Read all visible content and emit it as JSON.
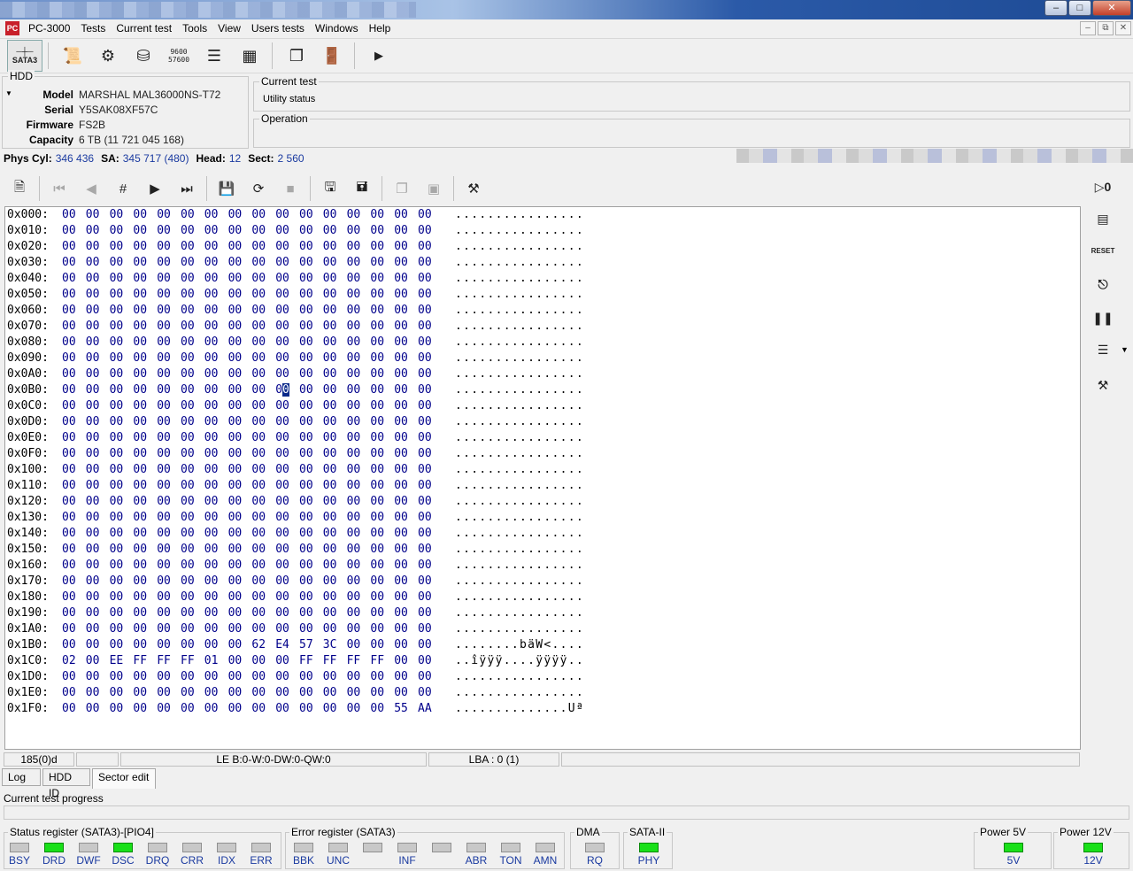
{
  "window": {
    "min": "–",
    "max": "□",
    "close": "✕"
  },
  "menu": {
    "app_icon_text": "PC",
    "items": [
      "PC-3000",
      "Tests",
      "Current test",
      "Tools",
      "View",
      "Users tests",
      "Windows",
      "Help"
    ],
    "mdi": [
      "–",
      "⧉",
      "✕"
    ]
  },
  "toolbar": {
    "sata_label": "SATA3",
    "baud_top": "9600",
    "baud_bottom": "57600"
  },
  "hdd": {
    "legend": "HDD",
    "fields": [
      {
        "label": "Model",
        "value": "MARSHAL MAL36000NS-T72"
      },
      {
        "label": "Serial",
        "value": "Y5SAK08XF57C"
      },
      {
        "label": "Firmware",
        "value": "FS2B"
      },
      {
        "label": "Capacity",
        "value": "6 TB (11 721 045 168)"
      }
    ]
  },
  "current_test": {
    "legend": "Current test",
    "status": "Utility status"
  },
  "operation": {
    "legend": "Operation"
  },
  "position": {
    "phys_cyl_label": "Phys Cyl:",
    "phys_cyl": "346 436",
    "sa_label": "SA:",
    "sa": "345 717 (480)",
    "head_label": "Head:",
    "head": "12",
    "sect_label": "Sect:",
    "sect": "2 560"
  },
  "hex": {
    "cursor": {
      "row": 11,
      "col": 9
    },
    "rows": [
      {
        "addr": "0x000:",
        "bytes": [
          "00",
          "00",
          "00",
          "00",
          "00",
          "00",
          "00",
          "00",
          "00",
          "00",
          "00",
          "00",
          "00",
          "00",
          "00",
          "00"
        ],
        "ascii": "................"
      },
      {
        "addr": "0x010:",
        "bytes": [
          "00",
          "00",
          "00",
          "00",
          "00",
          "00",
          "00",
          "00",
          "00",
          "00",
          "00",
          "00",
          "00",
          "00",
          "00",
          "00"
        ],
        "ascii": "................"
      },
      {
        "addr": "0x020:",
        "bytes": [
          "00",
          "00",
          "00",
          "00",
          "00",
          "00",
          "00",
          "00",
          "00",
          "00",
          "00",
          "00",
          "00",
          "00",
          "00",
          "00"
        ],
        "ascii": "................"
      },
      {
        "addr": "0x030:",
        "bytes": [
          "00",
          "00",
          "00",
          "00",
          "00",
          "00",
          "00",
          "00",
          "00",
          "00",
          "00",
          "00",
          "00",
          "00",
          "00",
          "00"
        ],
        "ascii": "................"
      },
      {
        "addr": "0x040:",
        "bytes": [
          "00",
          "00",
          "00",
          "00",
          "00",
          "00",
          "00",
          "00",
          "00",
          "00",
          "00",
          "00",
          "00",
          "00",
          "00",
          "00"
        ],
        "ascii": "................"
      },
      {
        "addr": "0x050:",
        "bytes": [
          "00",
          "00",
          "00",
          "00",
          "00",
          "00",
          "00",
          "00",
          "00",
          "00",
          "00",
          "00",
          "00",
          "00",
          "00",
          "00"
        ],
        "ascii": "................"
      },
      {
        "addr": "0x060:",
        "bytes": [
          "00",
          "00",
          "00",
          "00",
          "00",
          "00",
          "00",
          "00",
          "00",
          "00",
          "00",
          "00",
          "00",
          "00",
          "00",
          "00"
        ],
        "ascii": "................"
      },
      {
        "addr": "0x070:",
        "bytes": [
          "00",
          "00",
          "00",
          "00",
          "00",
          "00",
          "00",
          "00",
          "00",
          "00",
          "00",
          "00",
          "00",
          "00",
          "00",
          "00"
        ],
        "ascii": "................"
      },
      {
        "addr": "0x080:",
        "bytes": [
          "00",
          "00",
          "00",
          "00",
          "00",
          "00",
          "00",
          "00",
          "00",
          "00",
          "00",
          "00",
          "00",
          "00",
          "00",
          "00"
        ],
        "ascii": "................"
      },
      {
        "addr": "0x090:",
        "bytes": [
          "00",
          "00",
          "00",
          "00",
          "00",
          "00",
          "00",
          "00",
          "00",
          "00",
          "00",
          "00",
          "00",
          "00",
          "00",
          "00"
        ],
        "ascii": "................"
      },
      {
        "addr": "0x0A0:",
        "bytes": [
          "00",
          "00",
          "00",
          "00",
          "00",
          "00",
          "00",
          "00",
          "00",
          "00",
          "00",
          "00",
          "00",
          "00",
          "00",
          "00"
        ],
        "ascii": "................"
      },
      {
        "addr": "0x0B0:",
        "bytes": [
          "00",
          "00",
          "00",
          "00",
          "00",
          "00",
          "00",
          "00",
          "00",
          "00",
          "00",
          "00",
          "00",
          "00",
          "00",
          "00"
        ],
        "ascii": "................"
      },
      {
        "addr": "0x0C0:",
        "bytes": [
          "00",
          "00",
          "00",
          "00",
          "00",
          "00",
          "00",
          "00",
          "00",
          "00",
          "00",
          "00",
          "00",
          "00",
          "00",
          "00"
        ],
        "ascii": "................"
      },
      {
        "addr": "0x0D0:",
        "bytes": [
          "00",
          "00",
          "00",
          "00",
          "00",
          "00",
          "00",
          "00",
          "00",
          "00",
          "00",
          "00",
          "00",
          "00",
          "00",
          "00"
        ],
        "ascii": "................"
      },
      {
        "addr": "0x0E0:",
        "bytes": [
          "00",
          "00",
          "00",
          "00",
          "00",
          "00",
          "00",
          "00",
          "00",
          "00",
          "00",
          "00",
          "00",
          "00",
          "00",
          "00"
        ],
        "ascii": "................"
      },
      {
        "addr": "0x0F0:",
        "bytes": [
          "00",
          "00",
          "00",
          "00",
          "00",
          "00",
          "00",
          "00",
          "00",
          "00",
          "00",
          "00",
          "00",
          "00",
          "00",
          "00"
        ],
        "ascii": "................"
      },
      {
        "addr": "0x100:",
        "bytes": [
          "00",
          "00",
          "00",
          "00",
          "00",
          "00",
          "00",
          "00",
          "00",
          "00",
          "00",
          "00",
          "00",
          "00",
          "00",
          "00"
        ],
        "ascii": "................"
      },
      {
        "addr": "0x110:",
        "bytes": [
          "00",
          "00",
          "00",
          "00",
          "00",
          "00",
          "00",
          "00",
          "00",
          "00",
          "00",
          "00",
          "00",
          "00",
          "00",
          "00"
        ],
        "ascii": "................"
      },
      {
        "addr": "0x120:",
        "bytes": [
          "00",
          "00",
          "00",
          "00",
          "00",
          "00",
          "00",
          "00",
          "00",
          "00",
          "00",
          "00",
          "00",
          "00",
          "00",
          "00"
        ],
        "ascii": "................"
      },
      {
        "addr": "0x130:",
        "bytes": [
          "00",
          "00",
          "00",
          "00",
          "00",
          "00",
          "00",
          "00",
          "00",
          "00",
          "00",
          "00",
          "00",
          "00",
          "00",
          "00"
        ],
        "ascii": "................"
      },
      {
        "addr": "0x140:",
        "bytes": [
          "00",
          "00",
          "00",
          "00",
          "00",
          "00",
          "00",
          "00",
          "00",
          "00",
          "00",
          "00",
          "00",
          "00",
          "00",
          "00"
        ],
        "ascii": "................"
      },
      {
        "addr": "0x150:",
        "bytes": [
          "00",
          "00",
          "00",
          "00",
          "00",
          "00",
          "00",
          "00",
          "00",
          "00",
          "00",
          "00",
          "00",
          "00",
          "00",
          "00"
        ],
        "ascii": "................"
      },
      {
        "addr": "0x160:",
        "bytes": [
          "00",
          "00",
          "00",
          "00",
          "00",
          "00",
          "00",
          "00",
          "00",
          "00",
          "00",
          "00",
          "00",
          "00",
          "00",
          "00"
        ],
        "ascii": "................"
      },
      {
        "addr": "0x170:",
        "bytes": [
          "00",
          "00",
          "00",
          "00",
          "00",
          "00",
          "00",
          "00",
          "00",
          "00",
          "00",
          "00",
          "00",
          "00",
          "00",
          "00"
        ],
        "ascii": "................"
      },
      {
        "addr": "0x180:",
        "bytes": [
          "00",
          "00",
          "00",
          "00",
          "00",
          "00",
          "00",
          "00",
          "00",
          "00",
          "00",
          "00",
          "00",
          "00",
          "00",
          "00"
        ],
        "ascii": "................"
      },
      {
        "addr": "0x190:",
        "bytes": [
          "00",
          "00",
          "00",
          "00",
          "00",
          "00",
          "00",
          "00",
          "00",
          "00",
          "00",
          "00",
          "00",
          "00",
          "00",
          "00"
        ],
        "ascii": "................"
      },
      {
        "addr": "0x1A0:",
        "bytes": [
          "00",
          "00",
          "00",
          "00",
          "00",
          "00",
          "00",
          "00",
          "00",
          "00",
          "00",
          "00",
          "00",
          "00",
          "00",
          "00"
        ],
        "ascii": "................"
      },
      {
        "addr": "0x1B0:",
        "bytes": [
          "00",
          "00",
          "00",
          "00",
          "00",
          "00",
          "00",
          "00",
          "62",
          "E4",
          "57",
          "3C",
          "00",
          "00",
          "00",
          "00"
        ],
        "ascii": "........bäW<...."
      },
      {
        "addr": "0x1C0:",
        "bytes": [
          "02",
          "00",
          "EE",
          "FF",
          "FF",
          "FF",
          "01",
          "00",
          "00",
          "00",
          "FF",
          "FF",
          "FF",
          "FF",
          "00",
          "00"
        ],
        "ascii": "..îÿÿÿ....ÿÿÿÿ.."
      },
      {
        "addr": "0x1D0:",
        "bytes": [
          "00",
          "00",
          "00",
          "00",
          "00",
          "00",
          "00",
          "00",
          "00",
          "00",
          "00",
          "00",
          "00",
          "00",
          "00",
          "00"
        ],
        "ascii": "................"
      },
      {
        "addr": "0x1E0:",
        "bytes": [
          "00",
          "00",
          "00",
          "00",
          "00",
          "00",
          "00",
          "00",
          "00",
          "00",
          "00",
          "00",
          "00",
          "00",
          "00",
          "00"
        ],
        "ascii": "................"
      },
      {
        "addr": "0x1F0:",
        "bytes": [
          "00",
          "00",
          "00",
          "00",
          "00",
          "00",
          "00",
          "00",
          "00",
          "00",
          "00",
          "00",
          "00",
          "00",
          "55",
          "AA"
        ],
        "ascii": "..............Uª"
      }
    ]
  },
  "bottom_status": {
    "offset": "185(0)d",
    "le": "LE B:0-W:0-DW:0-QW:0",
    "lba": "LBA : 0 (1)"
  },
  "tabs": [
    {
      "label": "Log",
      "active": false
    },
    {
      "label": "HDD ID",
      "active": false
    },
    {
      "label": "Sector edit",
      "active": true
    }
  ],
  "progress": {
    "label": "Current test progress",
    "value": 0
  },
  "status_register": {
    "legend": "Status register (SATA3)-[PIO4]",
    "leds": [
      {
        "label": "BSY",
        "on": false
      },
      {
        "label": "DRD",
        "on": true
      },
      {
        "label": "DWF",
        "on": false
      },
      {
        "label": "DSC",
        "on": true
      },
      {
        "label": "DRQ",
        "on": false
      },
      {
        "label": "CRR",
        "on": false
      },
      {
        "label": "IDX",
        "on": false
      },
      {
        "label": "ERR",
        "on": false
      }
    ]
  },
  "error_register": {
    "legend": "Error register (SATA3)",
    "leds": [
      {
        "label": "BBK",
        "on": false
      },
      {
        "label": "UNC",
        "on": false
      },
      {
        "label": "",
        "on": false
      },
      {
        "label": "INF",
        "on": false
      },
      {
        "label": "",
        "on": false
      },
      {
        "label": "ABR",
        "on": false
      },
      {
        "label": "TON",
        "on": false
      },
      {
        "label": "AMN",
        "on": false
      }
    ]
  },
  "dma": {
    "legend": "DMA",
    "leds": [
      {
        "label": "RQ",
        "on": false
      }
    ]
  },
  "sata2": {
    "legend": "SATA-II",
    "leds": [
      {
        "label": "PHY",
        "on": true
      }
    ]
  },
  "power5": {
    "legend": "Power 5V",
    "leds": [
      {
        "label": "5V",
        "on": true
      }
    ]
  },
  "power12": {
    "legend": "Power 12V",
    "leds": [
      {
        "label": "12V",
        "on": true
      }
    ]
  },
  "colors": {
    "led_on": "#19e019",
    "led_off": "#c8c8c8",
    "value_blue": "#1a3aa0",
    "hex_blue": "#00008b"
  }
}
